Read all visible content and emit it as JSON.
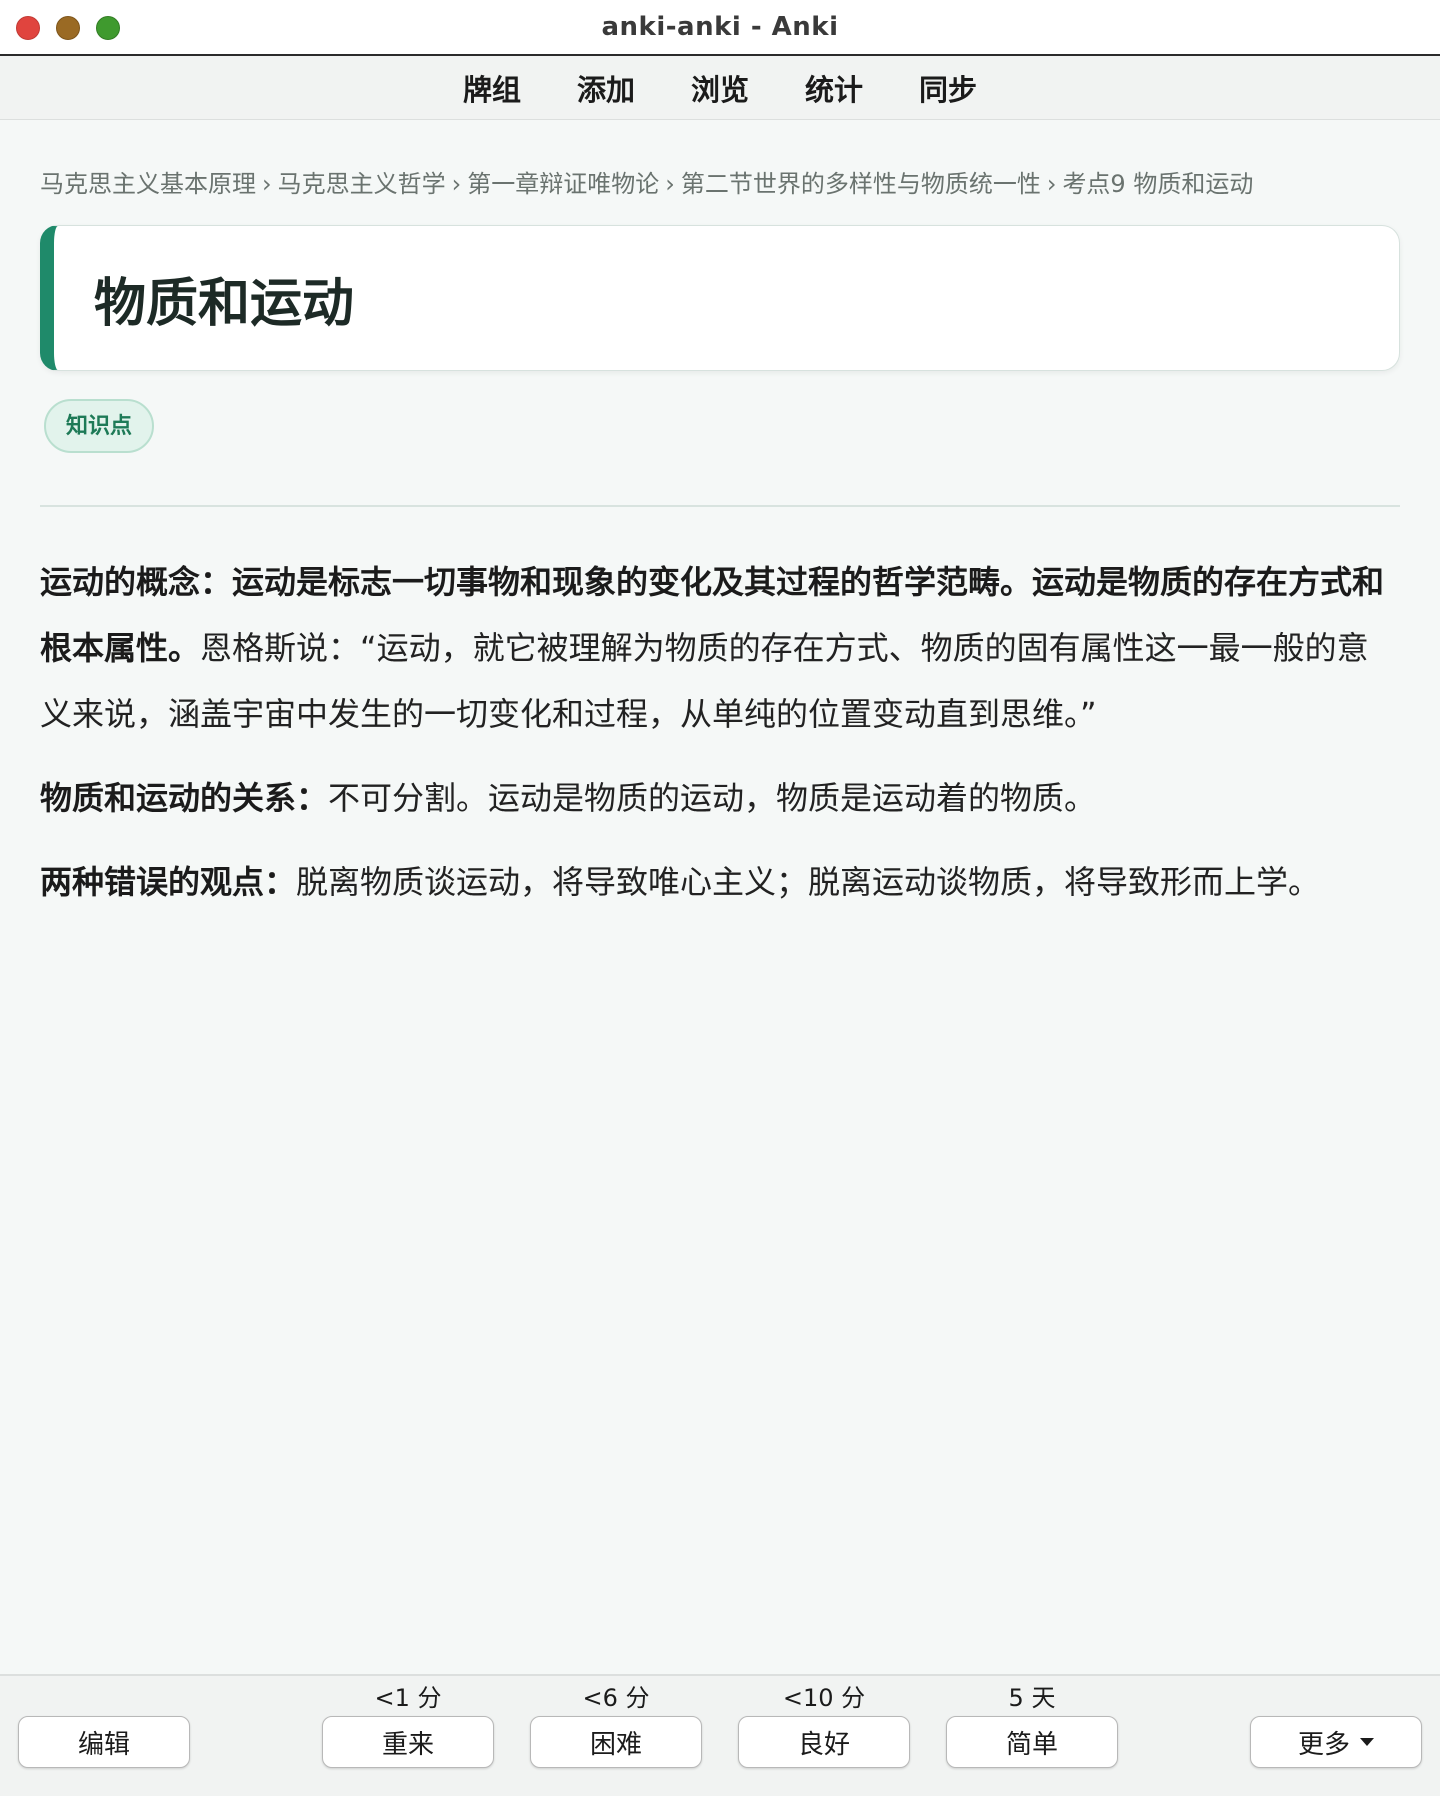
{
  "window": {
    "title": "anki-anki - Anki"
  },
  "toolbar": {
    "items": [
      "牌组",
      "添加",
      "浏览",
      "统计",
      "同步"
    ]
  },
  "breadcrumb": [
    "马克思主义基本原理",
    "马克思主义哲学",
    "第一章辩证唯物论",
    "第二节世界的多样性与物质统一性",
    "考点9 物质和运动"
  ],
  "card": {
    "title": "物质和运动",
    "tag": "知识点",
    "paragraphs": [
      {
        "bold": "运动的概念：运动是标志一切事物和现象的变化及其过程的哲学范畴。运动是物质的存在方式和根本属性。",
        "text": "恩格斯说：“运动，就它被理解为物质的存在方式、物质的固有属性这一最一般的意义来说，涵盖宇宙中发生的一切变化和过程，从单纯的位置变动直到思维。”"
      },
      {
        "bold": "物质和运动的关系：",
        "text": "不可分割。运动是物质的运动，物质是运动着的物质。"
      },
      {
        "bold": "两种错误的观点：",
        "text": "脱离物质谈运动，将导致唯心主义；脱离运动谈物质，将导致形而上学。"
      }
    ]
  },
  "bottombar": {
    "edit_label": "编辑",
    "more_label": "更多",
    "answers": [
      {
        "interval": "<1 分",
        "label": "重来"
      },
      {
        "interval": "<6 分",
        "label": "困难"
      },
      {
        "interval": "<10 分",
        "label": "良好"
      },
      {
        "interval": "5 天",
        "label": "简单"
      }
    ]
  }
}
